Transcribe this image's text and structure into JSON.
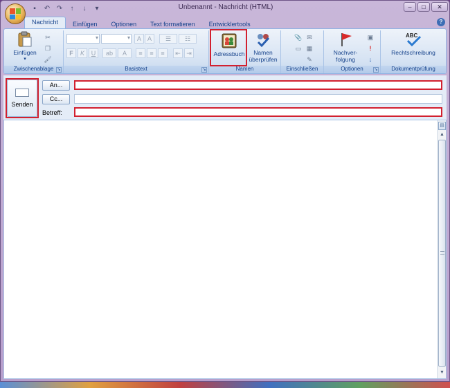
{
  "window": {
    "title": "Unbenannt - Nachricht (HTML)"
  },
  "quick_access": {
    "save_icon": "save-icon",
    "undo_icon": "undo-icon",
    "redo_icon": "redo-icon"
  },
  "tabs": [
    {
      "label": "Nachricht",
      "active": true
    },
    {
      "label": "Einfügen",
      "active": false
    },
    {
      "label": "Optionen",
      "active": false
    },
    {
      "label": "Text formatieren",
      "active": false
    },
    {
      "label": "Entwicklertools",
      "active": false
    }
  ],
  "ribbon": {
    "groups": {
      "clipboard": {
        "label": "Zwischenablage",
        "paste": "Einfügen"
      },
      "basic_text": {
        "label": "Basistext"
      },
      "names": {
        "label": "Namen",
        "address_book": "Adressbuch",
        "check_names": "Namen überprüfen",
        "check_names_line1": "Namen",
        "check_names_line2": "überprüfen"
      },
      "include": {
        "label": "Einschließen"
      },
      "options": {
        "label": "Optionen",
        "follow_up_line1": "Nachver-",
        "follow_up_line2": "folgung"
      },
      "proofing": {
        "label": "Dokumentprüfung",
        "spelling": "Rechtschreibung"
      }
    },
    "format_buttons": [
      "F",
      "K",
      "U"
    ]
  },
  "compose": {
    "send_label": "Senden",
    "to_button": "An...",
    "cc_button": "Cc...",
    "subject_label": "Betreff:",
    "to_value": "",
    "cc_value": "",
    "subject_value": ""
  },
  "colors": {
    "accent": "#15428b",
    "highlight": "#d2202f",
    "ribbon_border": "#8db2e3"
  }
}
